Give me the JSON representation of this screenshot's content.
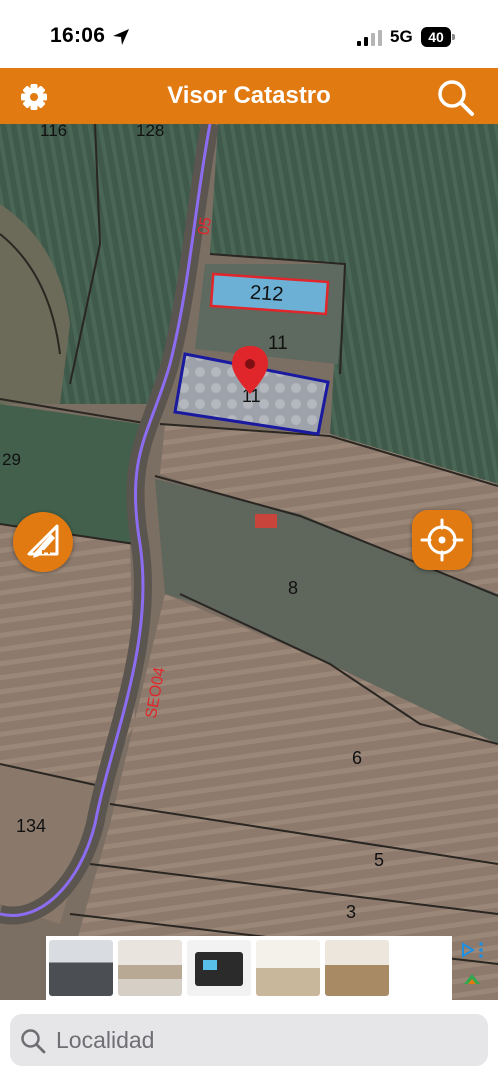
{
  "status_bar": {
    "time": "16:06",
    "network": "5G",
    "battery": "40"
  },
  "header": {
    "title": "Visor Catastro",
    "settings_icon": "gear-icon",
    "search_icon": "search-icon"
  },
  "map": {
    "parcel_labels": [
      "116",
      "128",
      "212",
      "11",
      "11",
      "29",
      "8",
      "6",
      "5",
      "3",
      "134"
    ],
    "road_labels": [
      "05",
      "SEO04"
    ],
    "selected_parcel": "11",
    "marker_icon": "map-pin-icon"
  },
  "map_controls": {
    "draw_icon": "measure-pencil-icon",
    "locate_icon": "crosshair-icon"
  },
  "ad": {
    "adchoices_icon": "adchoices-icon"
  },
  "search": {
    "placeholder": "Localidad"
  },
  "colors": {
    "accent": "#e27a12",
    "selected_parcel_border": "#1a1aa0",
    "highlight_parcel_border": "#e0262b",
    "road_line": "#8c6cf0"
  }
}
